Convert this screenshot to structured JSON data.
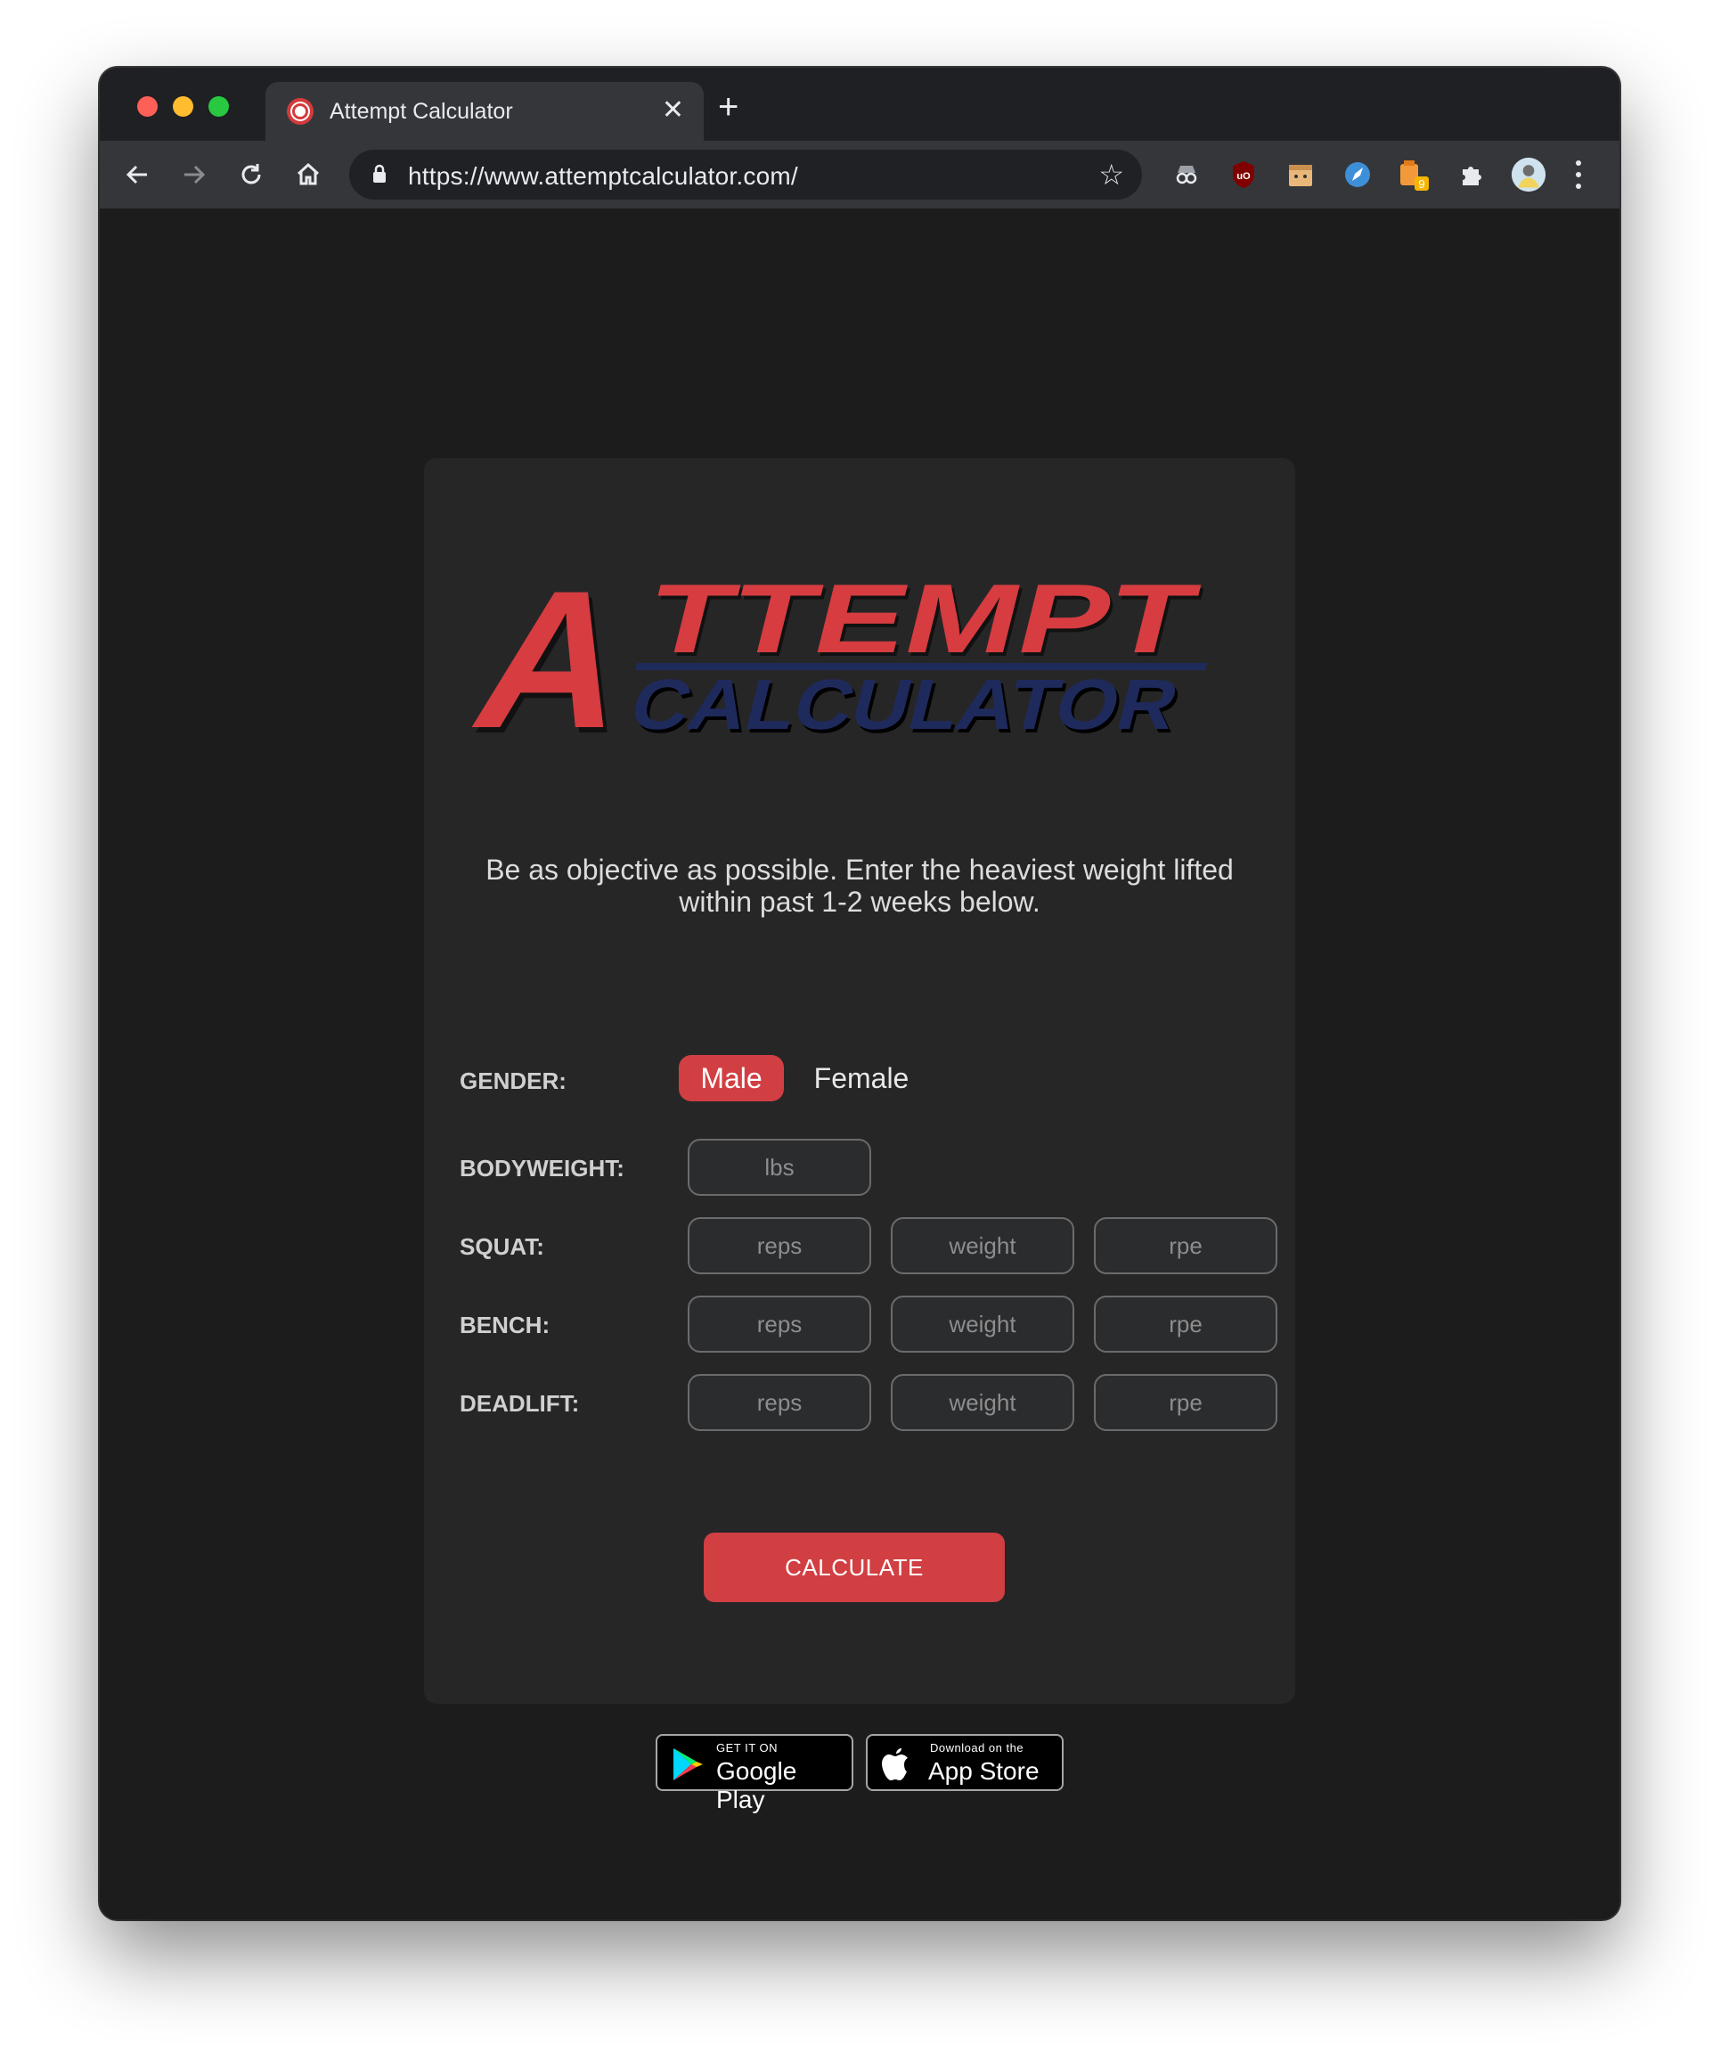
{
  "browser": {
    "tab_title": "Attempt Calculator",
    "url": "https://www.attemptcalculator.com/",
    "extension_badge": "9"
  },
  "logo": {
    "line1": "TTEMPT",
    "big_letter": "A",
    "line2": "CALCULATOR"
  },
  "intro_text": "Be as objective as possible. Enter the heaviest weight lifted within past 1-2 weeks below.",
  "form": {
    "gender_label": "GENDER:",
    "gender_options": [
      "Male",
      "Female"
    ],
    "gender_selected": "Male",
    "bodyweight_label": "BODYWEIGHT:",
    "bodyweight_placeholder": "lbs",
    "lifts": [
      {
        "label": "SQUAT:",
        "reps": "reps",
        "weight": "weight",
        "rpe": "rpe"
      },
      {
        "label": "BENCH:",
        "reps": "reps",
        "weight": "weight",
        "rpe": "rpe"
      },
      {
        "label": "DEADLIFT:",
        "reps": "reps",
        "weight": "weight",
        "rpe": "rpe"
      }
    ],
    "calculate_label": "CALCULATE"
  },
  "stores": {
    "google_small": "GET IT ON",
    "google_big": "Google Play",
    "apple_small": "Download on the",
    "apple_big": "App Store"
  },
  "colors": {
    "accent": "#d13f43",
    "logo_red": "#d63c40",
    "logo_navy": "#1f2a5c",
    "card_bg": "#262627",
    "page_bg": "#1c1c1d"
  }
}
